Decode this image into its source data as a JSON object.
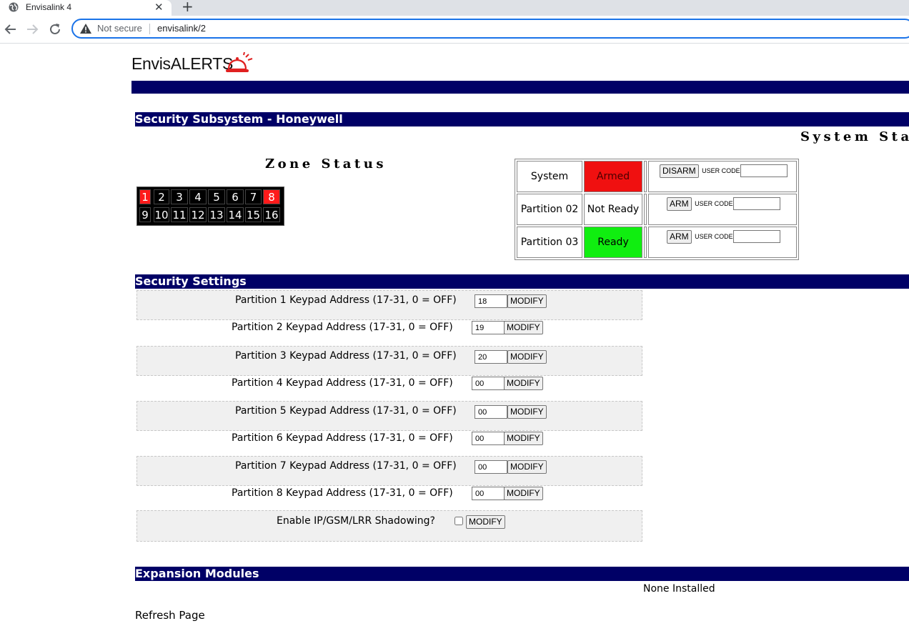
{
  "browser": {
    "tab_title": "Envisalink 4",
    "new_tab_label": "+",
    "close_label": "✕",
    "security_label": "Not secure",
    "url": "envisalink/2"
  },
  "logo": {
    "text": "EnvisALERTS"
  },
  "sections": {
    "subsystem": "Security Subsystem - Honeywell",
    "settings": "Security Settings",
    "expansion": "Expansion Modules"
  },
  "system_status_title": "System Sta",
  "zone_status_title": "Zone Status",
  "zones": {
    "labels": [
      "1",
      "2",
      "3",
      "4",
      "5",
      "6",
      "7",
      "8",
      "9",
      "10",
      "11",
      "12",
      "13",
      "14",
      "15",
      "16"
    ],
    "alarm": [
      "1",
      "8"
    ]
  },
  "partitions": [
    {
      "name": "System",
      "state": "Armed",
      "state_color": "#f01010",
      "button": "DISARM",
      "code_label": "USER CODE"
    },
    {
      "name": "Partition 02",
      "state": "Not Ready",
      "state_color": "#ffffff",
      "button": "ARM",
      "code_label": "USER CODE"
    },
    {
      "name": "Partition 03",
      "state": "Ready",
      "state_color": "#10ee10",
      "button": "ARM",
      "code_label": "USER CODE"
    }
  ],
  "settings": {
    "modify_label": "MODIFY",
    "rows": [
      {
        "label": "Partition 1 Keypad Address (17-31, 0 = OFF)",
        "value": "18"
      },
      {
        "label": "Partition 2 Keypad Address (17-31, 0 = OFF)",
        "value": "19"
      },
      {
        "label": "Partition 3 Keypad Address (17-31, 0 = OFF)",
        "value": "20"
      },
      {
        "label": "Partition 4 Keypad Address (17-31, 0 = OFF)",
        "value": "00"
      },
      {
        "label": "Partition 5 Keypad Address (17-31, 0 = OFF)",
        "value": "00"
      },
      {
        "label": "Partition 6 Keypad Address (17-31, 0 = OFF)",
        "value": "00"
      },
      {
        "label": "Partition 7 Keypad Address (17-31, 0 = OFF)",
        "value": "00"
      },
      {
        "label": "Partition 8 Keypad Address (17-31, 0 = OFF)",
        "value": "00"
      }
    ],
    "shadowing_label": "Enable IP/GSM/LRR Shadowing?",
    "shadowing_checked": false
  },
  "expansion": {
    "status": "None Installed"
  },
  "refresh_label": "Refresh Page",
  "colors": {
    "navy": "#000066",
    "alarm_red": "#ff1a1a",
    "ready_green": "#10ee10"
  }
}
